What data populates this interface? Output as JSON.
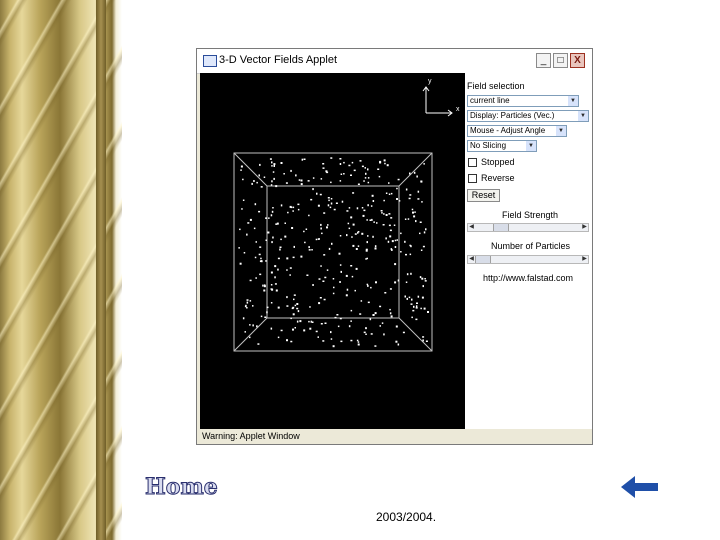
{
  "window": {
    "title": "3-D Vector Fields Applet",
    "minimize_label": "_",
    "maximize_label": "□",
    "close_label": "X"
  },
  "canvas": {
    "axis_y_label": "y",
    "axis_x_label": "x"
  },
  "panel": {
    "field_selection_label": "Field selection",
    "field_select_value": "current line",
    "display_select_value": "Display: Particles (Vec.)",
    "mouse_select_value": "Mouse - Adjust Angle",
    "slicing_select_value": "No Slicing",
    "stopped_label": "Stopped",
    "reverse_label": "Reverse",
    "reset_label": "Reset",
    "field_strength_label": "Field Strength",
    "num_particles_label": "Number of Particles",
    "url_text": "http://www.falstad.com",
    "field_strength_level": 0.2,
    "num_particles_level": 0.0
  },
  "status": {
    "warning_text": "Warning: Applet Window"
  },
  "page": {
    "home_label": "Home",
    "year_text": "2003/2004."
  },
  "colors": {
    "canvas_bg": "#000000",
    "particle": "#ffffff",
    "box_line": "#bfbfbf",
    "window_bg": "#ece9d8",
    "home_fill": "#d9dcf0",
    "arrow": "#1f4fa8"
  }
}
